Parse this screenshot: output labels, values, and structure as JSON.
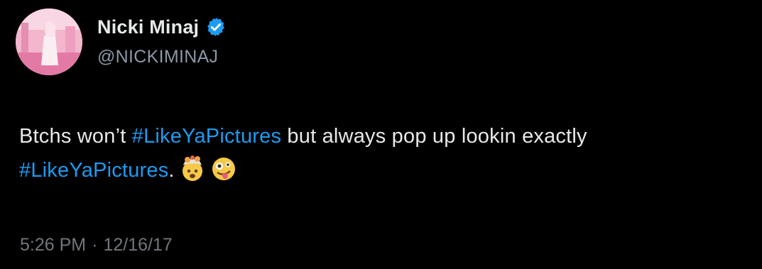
{
  "user": {
    "display_name": "Nicki Minaj",
    "handle": "@NICKIMINAJ",
    "verified": true
  },
  "tweet": {
    "text_part1": "Btchs won’t ",
    "hashtag1": "#LikeYaPictures",
    "text_part2": " but always pop up lookin exactly ",
    "hashtag2": "#LikeYaPictures",
    "text_part3": ".",
    "emojis": [
      "exploding-head-emoji",
      "zany-face-emoji"
    ]
  },
  "meta": {
    "time": "5:26 PM",
    "separator": "·",
    "date": "12/16/17"
  },
  "colors": {
    "background": "#000000",
    "text": "#e7e9ea",
    "hashtag": "#1d9bf0",
    "secondary": "#8b98a5",
    "verified_badge": "#1d9bf0"
  }
}
